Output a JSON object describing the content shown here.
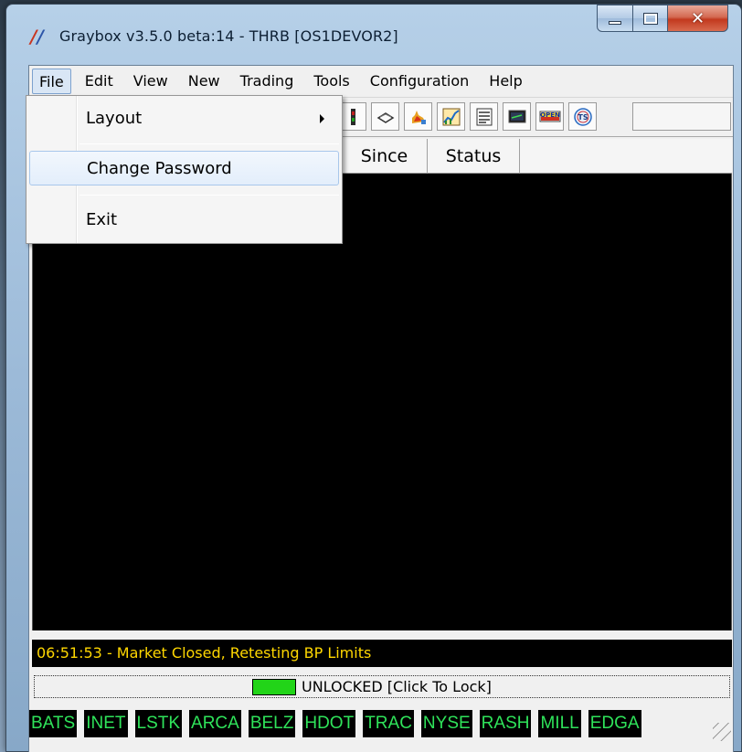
{
  "window": {
    "title": "Graybox v3.5.0 beta:14 - THRB [OS1DEVOR2]",
    "icon": "graybox-app-icon"
  },
  "menubar": [
    "File",
    "Edit",
    "View",
    "New",
    "Trading",
    "Tools",
    "Configuration",
    "Help"
  ],
  "file_menu": {
    "items": [
      {
        "label": "Layout",
        "has_submenu": true
      },
      {
        "label": "Change Password",
        "highlighted": true
      },
      {
        "label": "Exit"
      }
    ]
  },
  "table": {
    "columns": [
      "Since",
      "Status"
    ]
  },
  "status_message": "06:51:53 - Market Closed, Retesting BP Limits",
  "lock": {
    "label": "UNLOCKED [Click To Lock]",
    "indicator_color": "#22d418"
  },
  "venues": [
    "BATS",
    "INET",
    "LSTK",
    "ARCA",
    "BELZ",
    "HDOT",
    "TRAC",
    "NYSE",
    "RASH",
    "MILL",
    "EDGA"
  ],
  "colors": {
    "status_text": "#ffd700",
    "venue_text": "#2fe35a"
  }
}
